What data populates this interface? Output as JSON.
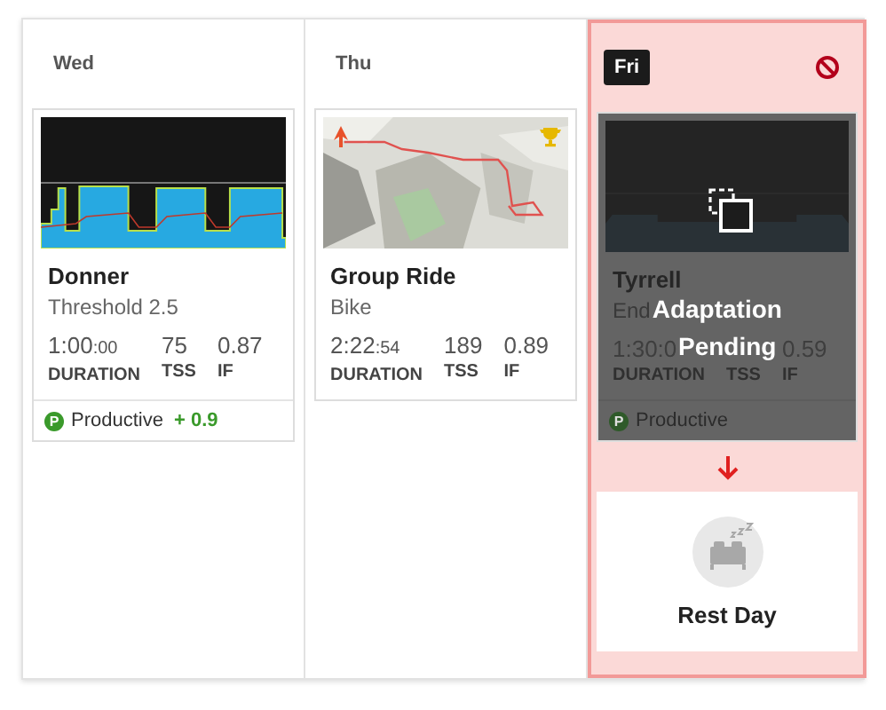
{
  "days": [
    {
      "label": "Wed",
      "selected": false,
      "blocked": false,
      "workout": {
        "kind": "graph",
        "title": "Donner",
        "subtitle": "Threshold 2.5",
        "has_trophy": false,
        "metrics": [
          {
            "value": "1:00",
            "small": ":00",
            "label": "DURATION"
          },
          {
            "value": "75",
            "label": "TSS"
          },
          {
            "value": "0.87",
            "label": "IF"
          }
        ],
        "compliance": {
          "badge": "P",
          "label": "Productive",
          "delta": "+ 0.9"
        }
      }
    },
    {
      "label": "Thu",
      "selected": false,
      "blocked": false,
      "workout": {
        "kind": "map",
        "title": "Group Ride",
        "subtitle": "Bike",
        "has_trophy": true,
        "metrics": [
          {
            "value": "2:22",
            "small": ":54",
            "label": "DURATION"
          },
          {
            "value": "189",
            "label": "TSS"
          },
          {
            "value": "0.89",
            "label": "IF"
          }
        ]
      }
    },
    {
      "label": "Fri",
      "selected": true,
      "blocked": true,
      "workout": {
        "kind": "pending",
        "title": "Tyrrell",
        "subtitle": "End",
        "has_trophy": false,
        "metrics": [
          {
            "value": "1:30:0",
            "label": "DURATION"
          },
          {
            "label": "TSS"
          },
          {
            "value": "0.59",
            "label": "IF"
          }
        ],
        "compliance": {
          "badge": "P",
          "label": "Productive"
        },
        "overlay_lines": [
          "Adaptation",
          "Pending"
        ]
      },
      "replacement": {
        "label": "Rest Day"
      }
    }
  ]
}
